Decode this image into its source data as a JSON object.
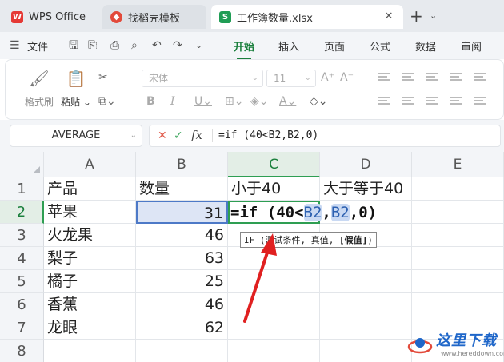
{
  "tabs": {
    "wps": "WPS Office",
    "template": "找稻壳模板",
    "file": "工作簿数量.xlsx",
    "close_icon": "close-icon",
    "add_icon": "plus-icon"
  },
  "menu": {
    "file_label": "文件",
    "tabs": [
      "开始",
      "插入",
      "页面",
      "公式",
      "数据",
      "审阅"
    ],
    "active_tab": "开始"
  },
  "toolbar": {
    "format_painter": "格式刷",
    "paste": "粘贴",
    "font_name": "宋体",
    "font_size": "11"
  },
  "formula_bar": {
    "name_box": "AVERAGE",
    "fx": "fx",
    "formula": "=if (40<B2,B2,0)"
  },
  "grid": {
    "columns": [
      "A",
      "B",
      "C",
      "D",
      "E"
    ],
    "rows": [
      "1",
      "2",
      "3",
      "4",
      "5",
      "6",
      "7",
      "8"
    ],
    "header_row": {
      "a": "产品",
      "b": "数量",
      "c": "小于40",
      "d": "大于等于40"
    },
    "data": [
      {
        "product": "苹果",
        "qty": "31"
      },
      {
        "product": "火龙果",
        "qty": "46"
      },
      {
        "product": "梨子",
        "qty": "63"
      },
      {
        "product": "橘子",
        "qty": "25"
      },
      {
        "product": "香蕉",
        "qty": "46"
      },
      {
        "product": "龙眼",
        "qty": "62"
      }
    ],
    "editing": {
      "prefix": "=if (40<",
      "ref1": "B2",
      "sep": ",",
      "ref2": "B2",
      "suffix": ",0)"
    },
    "tooltip": {
      "text": "IF (测试条件, 真值, ",
      "bold": "[假值]",
      "close": ")"
    }
  },
  "watermark": {
    "text": "这里下载",
    "sub": "www.hereddown.com"
  },
  "colors": {
    "accent_green": "#1a7f3c",
    "reference_blue": "#4d79c7",
    "arrow_red": "#e02020"
  }
}
